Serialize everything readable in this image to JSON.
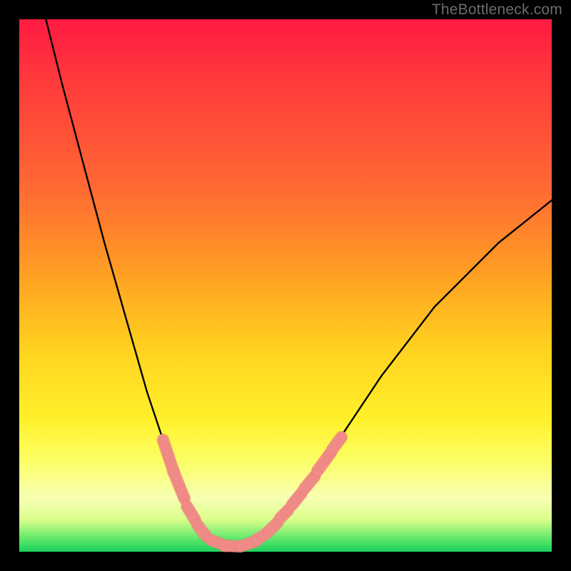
{
  "watermark": "TheBottleneck.com",
  "colors": {
    "background": "#000000",
    "curve": "#000000",
    "marker_fill": "#f08a86",
    "marker_stroke": "#e86e6a",
    "gradient_stops": [
      "#ff1a42",
      "#ff3b3b",
      "#ff6a33",
      "#ffa023",
      "#ffd21f",
      "#fff02a",
      "#fcff66",
      "#f7ffb3",
      "#d9ff8a",
      "#61e86b",
      "#19d15e"
    ]
  },
  "chart_data": {
    "type": "line",
    "title": "",
    "xlabel": "",
    "ylabel": "",
    "xlim": [
      0,
      100
    ],
    "ylim": [
      0,
      100
    ],
    "grid": false,
    "legend": false,
    "series": [
      {
        "name": "bottleneck-curve",
        "x": [
          5,
          8,
          12,
          16,
          20,
          24,
          27,
          29,
          31,
          33,
          34.5,
          36,
          37.5,
          39,
          41,
          43,
          45,
          47,
          50,
          54,
          60,
          68,
          78,
          90,
          100
        ],
        "y": [
          100,
          88,
          73,
          58,
          44,
          30,
          21,
          15,
          10,
          6,
          4,
          2.5,
          1.5,
          1,
          1,
          1.5,
          2.5,
          4,
          7,
          12,
          21,
          33,
          46,
          58,
          66
        ]
      }
    ],
    "markers": {
      "name": "highlighted-segments",
      "style": "pill",
      "color": "#f08a86",
      "segments": [
        {
          "x": [
            27,
            29
          ],
          "y": [
            21,
            15
          ]
        },
        {
          "x": [
            29,
            31
          ],
          "y": [
            15,
            10
          ]
        },
        {
          "x": [
            31.5,
            33
          ],
          "y": [
            8.5,
            6
          ]
        },
        {
          "x": [
            33.5,
            35
          ],
          "y": [
            5,
            3
          ]
        },
        {
          "x": [
            36,
            38.5
          ],
          "y": [
            2.2,
            1.2
          ]
        },
        {
          "x": [
            38.5,
            41.5
          ],
          "y": [
            1.1,
            1
          ]
        },
        {
          "x": [
            41.5,
            44.5
          ],
          "y": [
            1,
            2
          ]
        },
        {
          "x": [
            44.5,
            46.5
          ],
          "y": [
            2.2,
            3.5
          ]
        },
        {
          "x": [
            47,
            48.5
          ],
          "y": [
            4,
            5.5
          ]
        },
        {
          "x": [
            49,
            50.5
          ],
          "y": [
            6.3,
            7.8
          ]
        },
        {
          "x": [
            51.2,
            53
          ],
          "y": [
            8.8,
            11
          ]
        },
        {
          "x": [
            53.5,
            55.5
          ],
          "y": [
            11.8,
            14.2
          ]
        },
        {
          "x": [
            56,
            58.5
          ],
          "y": [
            15.2,
            18.6
          ]
        },
        {
          "x": [
            58.8,
            60.5
          ],
          "y": [
            19.2,
            21.5
          ]
        }
      ]
    }
  }
}
